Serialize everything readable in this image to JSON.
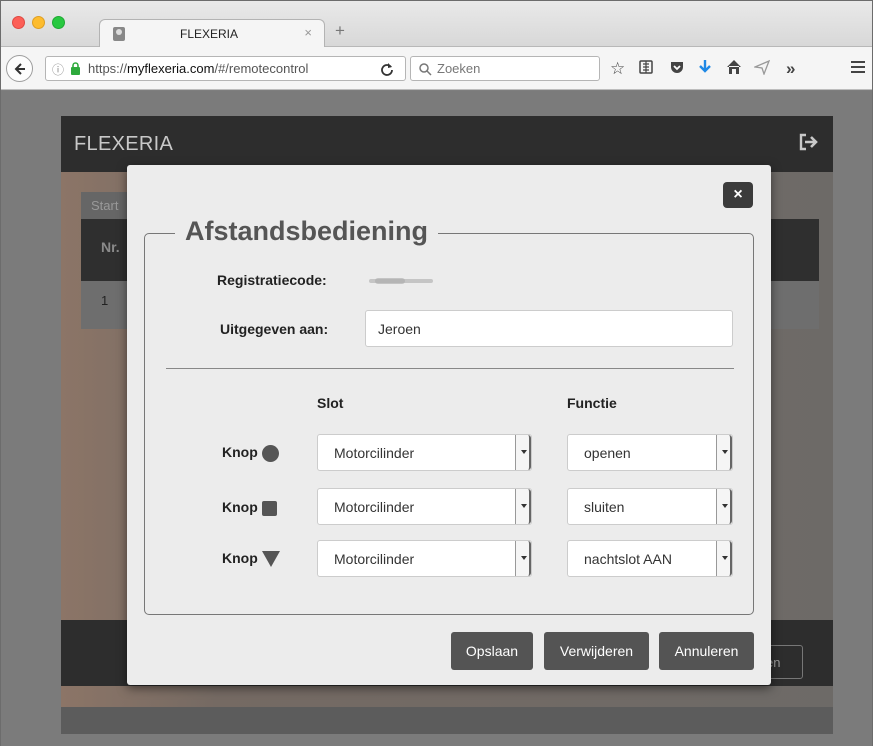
{
  "browser": {
    "tab_title": "FLEXERIA",
    "tab_close": "×",
    "new_tab": "+",
    "url_prefix": "https://",
    "url_host": "myflexeria.com",
    "url_path": "/#/remotecontrol",
    "search_placeholder": "Zoeken",
    "overflow": "»"
  },
  "app": {
    "brand": "FLEXERIA",
    "bg_tab": "Start",
    "bg_table_header": "Nr.",
    "bg_row_number": "1",
    "bg_footer_button": "en"
  },
  "modal": {
    "close_label": "×",
    "title": "Afstandsbediening",
    "regcode_label": "Registratiecode:",
    "issued_label": "Uitgegeven aan:",
    "issued_value": "Jeroen",
    "col_slot": "Slot",
    "col_function": "Functie",
    "buttons": [
      {
        "label": "Knop",
        "shape": "circle",
        "slot": "Motorcilinder",
        "function": "openen"
      },
      {
        "label": "Knop",
        "shape": "square",
        "slot": "Motorcilinder",
        "function": "sluiten"
      },
      {
        "label": "Knop",
        "shape": "triangle",
        "slot": "Motorcilinder",
        "function": "nachtslot AAN"
      }
    ],
    "actions": {
      "save": "Opslaan",
      "delete": "Verwijderen",
      "cancel": "Annuleren"
    }
  },
  "colors": {
    "header_bg": "#2d2d2d",
    "modal_bg": "#ececec",
    "button_bg": "#545454",
    "close_bg": "#3b3b3b"
  }
}
